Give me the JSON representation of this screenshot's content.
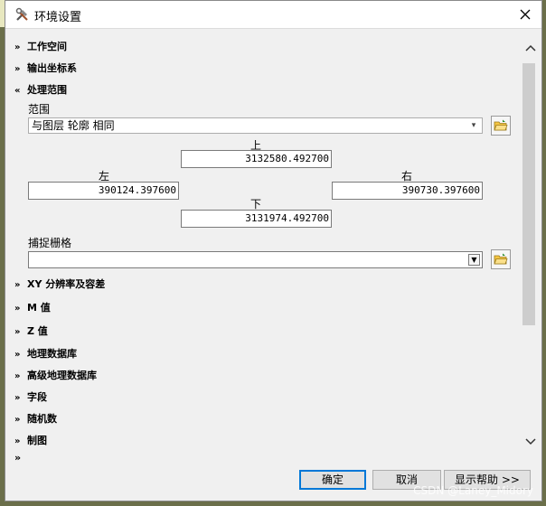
{
  "window": {
    "title": "环境设置"
  },
  "sections_top": [
    {
      "label": "工作空间"
    },
    {
      "label": "输出坐标系"
    },
    {
      "label": "处理范围"
    }
  ],
  "extent": {
    "range_label": "范围",
    "range_value": "与图层 轮廓 相同",
    "top_label": "上",
    "top_value": "3132580.492700",
    "left_label": "左",
    "left_value": "390124.397600",
    "right_label": "右",
    "right_value": "390730.397600",
    "bottom_label": "下",
    "bottom_value": "3131974.492700",
    "snap_label": "捕捉栅格",
    "snap_value": ""
  },
  "sections_bottom": [
    {
      "label": "XY 分辨率及容差"
    },
    {
      "label": "M 值"
    },
    {
      "label": "Z 值"
    },
    {
      "label": "地理数据库"
    },
    {
      "label": "高级地理数据库"
    },
    {
      "label": "字段"
    },
    {
      "label": "随机数"
    },
    {
      "label": "制图"
    }
  ],
  "buttons": {
    "ok": "确定",
    "cancel": "取消",
    "help": "显示帮助 >>"
  },
  "watermark": "CSDN @Laney_Midory"
}
